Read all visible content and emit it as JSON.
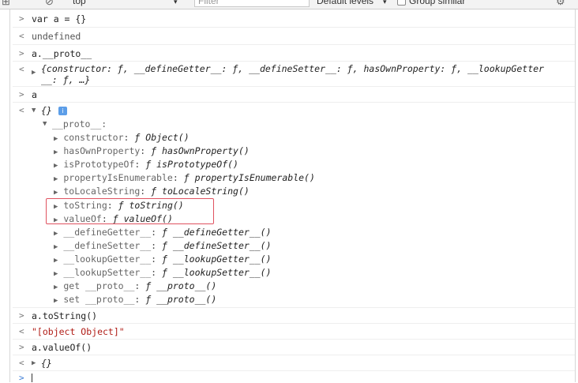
{
  "toolbar": {
    "context": "top",
    "filter_placeholder": "Filter",
    "levels": "Default levels",
    "group_similar": "Group similar"
  },
  "console": {
    "entries": [
      {
        "kind": "input",
        "text": "var a = {}"
      },
      {
        "kind": "output",
        "text": "undefined"
      },
      {
        "kind": "input",
        "text": "a.__proto__"
      },
      {
        "kind": "output",
        "line1": "{constructor: ƒ, __defineGetter__: ƒ, __defineSetter__: ƒ, hasOwnProperty: ƒ, __lookupGetter",
        "line2": "__: ƒ, …}"
      },
      {
        "kind": "input",
        "text": "a"
      },
      {
        "kind": "output",
        "text": "{}",
        "info": "i"
      }
    ],
    "proto_label": "__proto__:",
    "proto_props": [
      {
        "key": "constructor",
        "fn": "Object()"
      },
      {
        "key": "hasOwnProperty",
        "fn": "hasOwnProperty()"
      },
      {
        "key": "isPrototypeOf",
        "fn": "isPrototypeOf()"
      },
      {
        "key": "propertyIsEnumerable",
        "fn": "propertyIsEnumerable()"
      },
      {
        "key": "toLocaleString",
        "fn": "toLocaleString()"
      },
      {
        "key": "toString",
        "fn": "toString()"
      },
      {
        "key": "valueOf",
        "fn": "valueOf()"
      },
      {
        "key": "__defineGetter__",
        "fn": "__defineGetter__()"
      },
      {
        "key": "__defineSetter__",
        "fn": "__defineSetter__()"
      },
      {
        "key": "__lookupGetter__",
        "fn": "__lookupGetter__()"
      },
      {
        "key": "__lookupSetter__",
        "fn": "__lookupSetter__()"
      },
      {
        "key": "get __proto__",
        "fn": "__proto__()"
      },
      {
        "key": "set __proto__",
        "fn": "__proto__()"
      }
    ],
    "after": [
      {
        "kind": "input",
        "text": "a.toString()"
      },
      {
        "kind": "output",
        "text": "\"[object Object]\""
      },
      {
        "kind": "input",
        "text": "a.valueOf()"
      },
      {
        "kind": "output",
        "text": "{}"
      }
    ],
    "fn_symbol": "ƒ",
    "prompt_in": ">",
    "prompt_out": "<",
    "expand_closed": "▶",
    "expand_open": "▼"
  }
}
